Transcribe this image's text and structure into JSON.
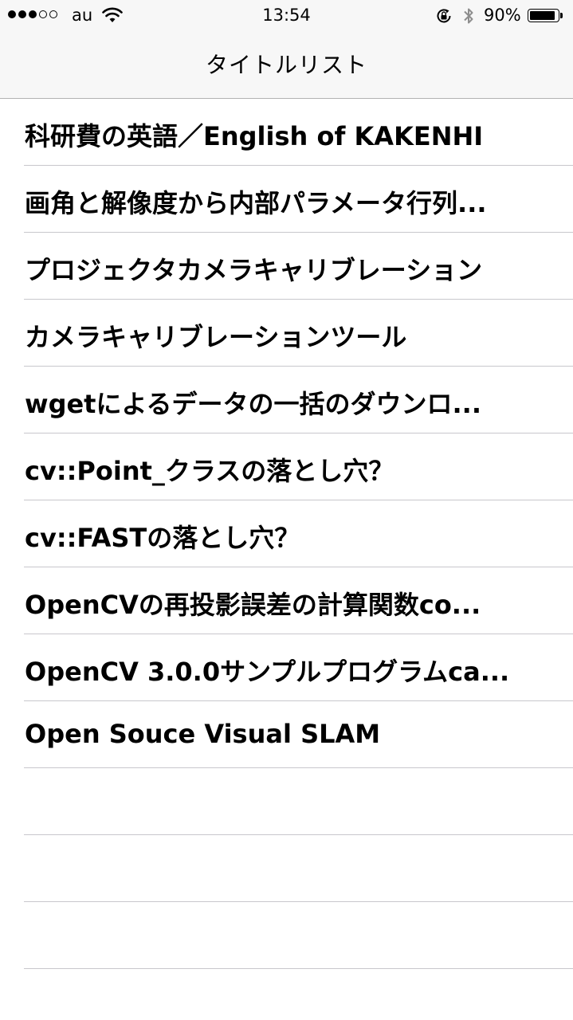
{
  "status_bar": {
    "signal_bars_total": 5,
    "signal_bars_filled": 3,
    "carrier": "au",
    "time": "13:54",
    "battery_percent": "90%",
    "battery_level": 0.9,
    "icons": [
      "wifi-icon",
      "rotation-lock-icon",
      "bluetooth-icon",
      "battery-icon"
    ]
  },
  "nav": {
    "title": "タイトルリスト"
  },
  "list": {
    "items": [
      "科研費の英語／English of KAKENHI",
      "画角と解像度から内部パラメータ行列...",
      "プロジェクタカメラキャリブレーション",
      "カメラキャリブレーションツール",
      "wgetによるデータの一括のダウンロ...",
      "cv::Point_クラスの落とし穴？",
      "cv::FASTの落とし穴？",
      "OpenCVの再投影誤差の計算関数co...",
      "OpenCV 3.0.0サンプルプログラムca...",
      "Open Souce Visual SLAM",
      "",
      "",
      "",
      ""
    ]
  }
}
